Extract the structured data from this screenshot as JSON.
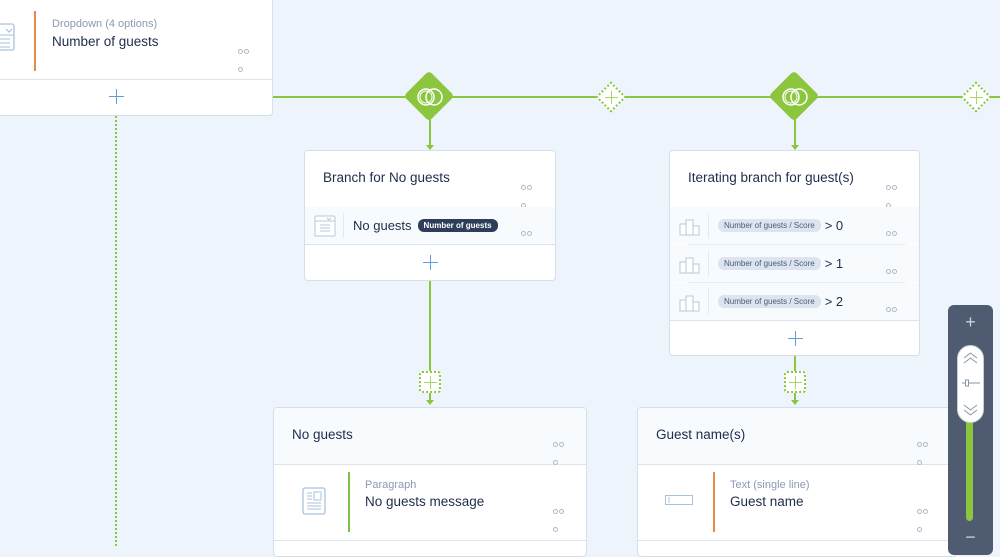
{
  "colors": {
    "canvas_bg": "#edf4fb",
    "connector_green": "#8cc63f",
    "accent_orange": "#e8894a",
    "accent_green": "#7cc242",
    "add_blue": "#5d9fdc",
    "zoom_panel": "#4e5b70"
  },
  "top_left_card": {
    "field": {
      "type_label": "Dropdown (4 options)",
      "name": "Number of guests",
      "icon": "dropdown-list-icon",
      "accent": "orange"
    },
    "add_icon": "plus-icon"
  },
  "branch_nodes": [
    {
      "icon": "branch-overlap-circles-icon",
      "kind": "branch"
    },
    {
      "icon": "branch-overlap-circles-icon",
      "kind": "branch"
    }
  ],
  "ghost_add_nodes": [
    {
      "icon": "plus-icon",
      "kind": "add-branch"
    },
    {
      "icon": "plus-icon",
      "kind": "add-branch"
    },
    {
      "icon": "plus-icon",
      "kind": "add-step"
    },
    {
      "icon": "plus-icon",
      "kind": "add-step"
    }
  ],
  "branch_no_guests": {
    "title": "Branch for No guests",
    "conditions": [
      {
        "icon": "dropdown-list-icon",
        "label": "No guests",
        "tag": "Number of guests"
      }
    ]
  },
  "branch_iterating": {
    "title": "Iterating branch for guest(s)",
    "conditions": [
      {
        "icon": "ranking-podium-icon",
        "tag": "Number of guests / Score",
        "expr": "> 0"
      },
      {
        "icon": "ranking-podium-icon",
        "tag": "Number of guests / Score",
        "expr": "> 1"
      },
      {
        "icon": "ranking-podium-icon",
        "tag": "Number of guests / Score",
        "expr": "> 2"
      }
    ]
  },
  "section_no_guests": {
    "title": "No guests",
    "field": {
      "type_label": "Paragraph",
      "name": "No guests message",
      "icon": "paragraph-icon",
      "accent": "green"
    }
  },
  "section_guest_names": {
    "title": "Guest name(s)",
    "field": {
      "type_label": "Text (single line)",
      "name": "Guest name",
      "icon": "text-input-icon",
      "accent": "orange"
    }
  },
  "zoom_control": {
    "zoom_in": "+",
    "zoom_out": "−",
    "level_fraction": 0.62
  }
}
